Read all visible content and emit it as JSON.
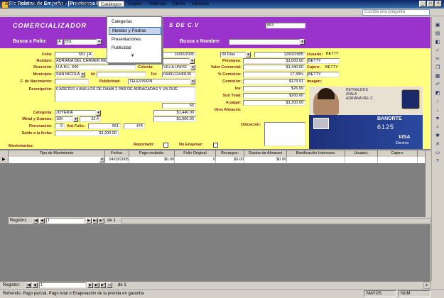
{
  "window": {
    "title": "Sic Boletas de Empeño - [Prestamos Personales]"
  },
  "menu": {
    "items": [
      "Archivo",
      "Edición",
      "Insertar",
      "Reportes",
      "Catálogos",
      "Cajero",
      "Utilerías",
      "Cierre",
      "Ventana"
    ],
    "ask_placeholder": "Escriba una pregunta"
  },
  "catalog_menu": {
    "items": [
      "Categorias",
      "Metales y Piedras",
      "Presentaciones",
      "Publicidad"
    ],
    "highlighted": "Metales y Piedras"
  },
  "header": {
    "company": "COMERCIALIZADOR",
    "company_suffix": "S DE C.V",
    "code": "553",
    "busca_folio_label": "Busca x Folio:",
    "folio_prefix": "A",
    "folio_value": "551",
    "busca_nombre_label": "Busca x Nombre:"
  },
  "form": {
    "folio_label": "Folio:",
    "folio_value": "551",
    "folio_letter": "A",
    "fecha_value": "10/02/2005",
    "plazo_value": "30 Días",
    "fecha2_value": "12/03/2005",
    "usuario_label": "Usuario:",
    "usuario_value": "BETTY",
    "nombre_label": "Nombre:",
    "nombre_value": "ADRIANA DEL CARMEN REYNALDOS AYALA",
    "prestamo_label": "Préstamo:",
    "prestamo_value": "$1,000.00",
    "direccion_label": "Dirección:",
    "direccion_value": "U.A.N.L. 505",
    "colonia_label": "Colonia:",
    "colonia_value": "VILLA UNIVE",
    "valor_label": "Valor Comercial:",
    "valor_value": "$1,440.00",
    "cajero_label": "Cajero:",
    "cajero_value": "BETTY",
    "municipio_label": "Municipio:",
    "municipio_value": "SAN NICOLAS",
    "id_label": "Id:",
    "tel_label": "Tel:",
    "tel_value": "0440112440105",
    "comision_pct_label": "% Comisión:",
    "comision_pct_value": "17.39%",
    "comision_pct_extra": "BETTY",
    "nacimiento_label": "F. de Nacimiento:",
    "publicidad_label": "Publicidad:",
    "publicidad_value": "TELEVISION",
    "comision_label": "Comisión:",
    "comision_value": "$173.91",
    "imagen_label": "Imagen:",
    "descripcion_label": "Descripción:",
    "descripcion_value": "6 ARETES 4 ANILLOS DE DAMA 2 PAR DE ARRACADAS Y UN DIJE",
    "iva_label": "Iva:",
    "iva_value": "$26.09",
    "subtotal_label": "Sub Total:",
    "subtotal_value": "$200.00",
    "apagar_label": "A pagar:",
    "apagar_value": "$1,200.00",
    "otros_label": "Otos Almacen:",
    "desc_num": "65",
    "categoria_label": "Categoría:",
    "categoria_value": "JOYERIA",
    "categoria_amount": "$1,440.00",
    "metal_label": "Metal y Gramos:",
    "metal_value": "10K",
    "gramos_value": "22.4",
    "metal_amount": "$1,000.00",
    "ubicacion_label": "Ubicación:",
    "renovacion_label": "Renovación:",
    "renovacion_value": "0",
    "antfolio_label": "Ant Folio:",
    "antfolio_value": "551",
    "antfolio_extra": "474",
    "saldo_label": "Saldo a la fecha:",
    "saldo_value": "$1,200.00",
    "movimientos_label": "Movimientos:",
    "reportado_label": "Reportado:",
    "noenajenar_label": "No Enajenar:"
  },
  "id_card": {
    "line1": "REYNALDOS",
    "line2": "AYALA",
    "line3": "ADRIANA DEL C",
    "bank": "BANORTE",
    "number": "6125",
    "brand": "VISA",
    "brand2": "Electron"
  },
  "grid": {
    "columns": [
      "Tipo de Movimiento",
      "Fecha:",
      "Pago recibido:",
      "Folio Original",
      "Recargos:",
      "Gastos de Almacen",
      "Bonificación Intereses:",
      "Usuario:",
      "Cajero:"
    ],
    "row": [
      "",
      "04/03/2005",
      "$0.00",
      "0",
      "$0.00",
      "$0.00",
      "",
      "",
      ""
    ]
  },
  "subnav": {
    "label": "Registro:",
    "current": "1",
    "of": "de 1"
  },
  "mainnav": {
    "label": "Registro:",
    "current": "1",
    "of": "de 1"
  },
  "status": {
    "text": "Refrendo, Pago parcial, Pago total o Enajenación de la prenda en garantía",
    "caps": "MAYÚS",
    "num": "NUM"
  },
  "colors": {
    "header": "#9933cc",
    "form": "#ffff80",
    "labels": "#7a1a1a"
  }
}
